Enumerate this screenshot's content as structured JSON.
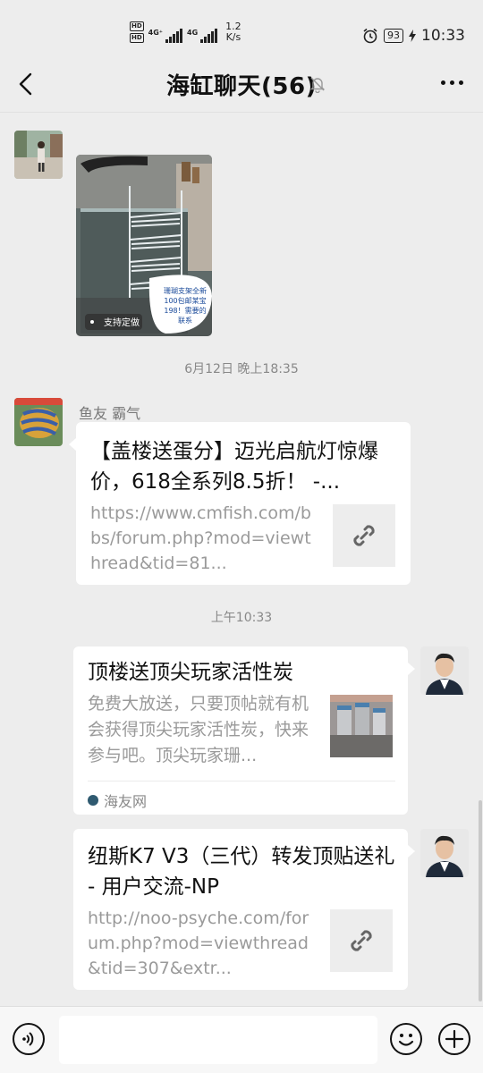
{
  "status_bar": {
    "hd_badges": [
      "HD",
      "HD"
    ],
    "signal1_label": "4G⁺",
    "signal2_label": "4G",
    "speed_value": "1.2",
    "speed_unit": "K/s",
    "battery": "93",
    "time": "10:33"
  },
  "header": {
    "title": "海缸聊天(56)"
  },
  "messages": {
    "image_msg": {
      "caption": "支持定做",
      "sticker": "珊瑚支架全新100包邮某宝198！需要的联系"
    },
    "timestamp1": "6月12日 晚上18:35",
    "sender1": "鱼友 霸气",
    "link1": {
      "title": "【盖楼送蛋分】迈光启航灯惊爆价，618全系列8.5折！ -...",
      "url": "https://www.cmfish.com/bbs/forum.php?mod=viewthread&tid=81..."
    },
    "timestamp2": "上午10:33",
    "link2": {
      "title": "顶楼送顶尖玩家活性炭",
      "desc": "免费大放送，只要顶帖就有机会获得顶尖玩家活性炭，快来参与吧。顶尖玩家珊...",
      "source": "海友网"
    },
    "link3": {
      "title": "纽斯K7 V3（三代）转发顶贴送礼 - 用户交流-NP",
      "url": "http://noo-psyche.com/forum.php?mod=viewthread&tid=307&extr..."
    }
  },
  "input_bar": {
    "value": ""
  },
  "colors": {
    "background": "#ededed",
    "bubble": "#ffffff",
    "secondary_text": "#9a9a9a"
  }
}
